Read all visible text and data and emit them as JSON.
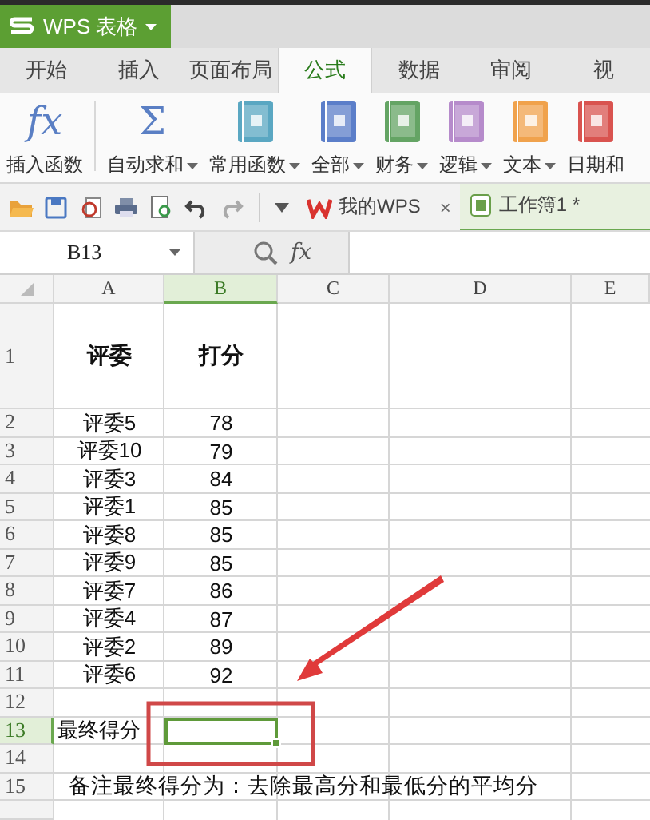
{
  "app_button": {
    "label": "WPS 表格"
  },
  "ribbon_tabs": [
    {
      "label": "开始",
      "selected": false
    },
    {
      "label": "插入",
      "selected": false
    },
    {
      "label": "页面布局",
      "selected": false
    },
    {
      "label": "公式",
      "selected": true
    },
    {
      "label": "数据",
      "selected": false
    },
    {
      "label": "审阅",
      "selected": false
    },
    {
      "label": "视",
      "selected": false
    }
  ],
  "ribbon_commands": [
    {
      "label": "插入函数",
      "kind": "glyph",
      "icon_text": "fx",
      "dropdown": false
    },
    {
      "label": "自动求和",
      "kind": "glyph",
      "icon_text": "Σ",
      "dropdown": true
    },
    {
      "label": "常用函数",
      "kind": "book",
      "color": "#5aa7c2",
      "dropdown": true
    },
    {
      "label": "全部",
      "kind": "book",
      "color": "#5b7ec9",
      "dropdown": true
    },
    {
      "label": "财务",
      "kind": "book",
      "color": "#64a464",
      "dropdown": true
    },
    {
      "label": "逻辑",
      "kind": "book",
      "color": "#b68bcb",
      "dropdown": true
    },
    {
      "label": "文本",
      "kind": "book",
      "color": "#f0a24c",
      "dropdown": true
    },
    {
      "label": "日期和",
      "kind": "book",
      "color": "#d9534f",
      "dropdown": false
    }
  ],
  "doc_tabs": [
    {
      "label": "我的WPS",
      "kind": "home",
      "selected": false,
      "closable": true,
      "close_label": "×"
    },
    {
      "label": "工作簿1 *",
      "kind": "workbook",
      "selected": true,
      "closable": false
    }
  ],
  "name_box": {
    "value": "B13"
  },
  "formula_bar": {
    "fx_label": "fx"
  },
  "sheet": {
    "columns": [
      {
        "label": "A",
        "selected": false
      },
      {
        "label": "B",
        "selected": true
      },
      {
        "label": "C",
        "selected": false
      },
      {
        "label": "D",
        "selected": false
      },
      {
        "label": "E",
        "selected": false
      }
    ],
    "rows": [
      {
        "number": "1",
        "kind": "heading",
        "selected": false,
        "cells": [
          {
            "text": "评委",
            "selected": false
          },
          {
            "text": "打分",
            "selected": false
          }
        ]
      },
      {
        "number": "2",
        "kind": "data",
        "selected": false,
        "cells": [
          {
            "text": "评委5",
            "selected": false
          },
          {
            "text": "78",
            "selected": false
          }
        ]
      },
      {
        "number": "3",
        "kind": "data",
        "selected": false,
        "cells": [
          {
            "text": "评委10",
            "selected": false
          },
          {
            "text": "79",
            "selected": false
          }
        ]
      },
      {
        "number": "4",
        "kind": "data",
        "selected": false,
        "cells": [
          {
            "text": "评委3",
            "selected": false
          },
          {
            "text": "84",
            "selected": false
          }
        ]
      },
      {
        "number": "5",
        "kind": "data",
        "selected": false,
        "cells": [
          {
            "text": "评委1",
            "selected": false
          },
          {
            "text": "85",
            "selected": false
          }
        ]
      },
      {
        "number": "6",
        "kind": "data",
        "selected": false,
        "cells": [
          {
            "text": "评委8",
            "selected": false
          },
          {
            "text": "85",
            "selected": false
          }
        ]
      },
      {
        "number": "7",
        "kind": "data",
        "selected": false,
        "cells": [
          {
            "text": "评委9",
            "selected": false
          },
          {
            "text": "85",
            "selected": false
          }
        ]
      },
      {
        "number": "8",
        "kind": "data",
        "selected": false,
        "cells": [
          {
            "text": "评委7",
            "selected": false
          },
          {
            "text": "86",
            "selected": false
          }
        ]
      },
      {
        "number": "9",
        "kind": "data",
        "selected": false,
        "cells": [
          {
            "text": "评委4",
            "selected": false
          },
          {
            "text": "87",
            "selected": false
          }
        ]
      },
      {
        "number": "10",
        "kind": "data",
        "selected": false,
        "cells": [
          {
            "text": "评委2",
            "selected": false
          },
          {
            "text": "89",
            "selected": false
          }
        ]
      },
      {
        "number": "11",
        "kind": "data",
        "selected": false,
        "cells": [
          {
            "text": "评委6",
            "selected": false
          },
          {
            "text": "92",
            "selected": false
          }
        ]
      },
      {
        "number": "12",
        "kind": "data",
        "selected": false,
        "cells": []
      },
      {
        "number": "13",
        "kind": "label",
        "selected": true,
        "cells": [
          {
            "text": "最终得分",
            "selected": false
          },
          {
            "selected": true
          }
        ]
      },
      {
        "number": "14",
        "kind": "data",
        "selected": false,
        "cells": []
      },
      {
        "number": "15",
        "kind": "note",
        "selected": false,
        "cells": [
          {
            "text": "备注最终得分为：去除最高分和最低分的平均分",
            "selected": false
          }
        ]
      }
    ]
  }
}
